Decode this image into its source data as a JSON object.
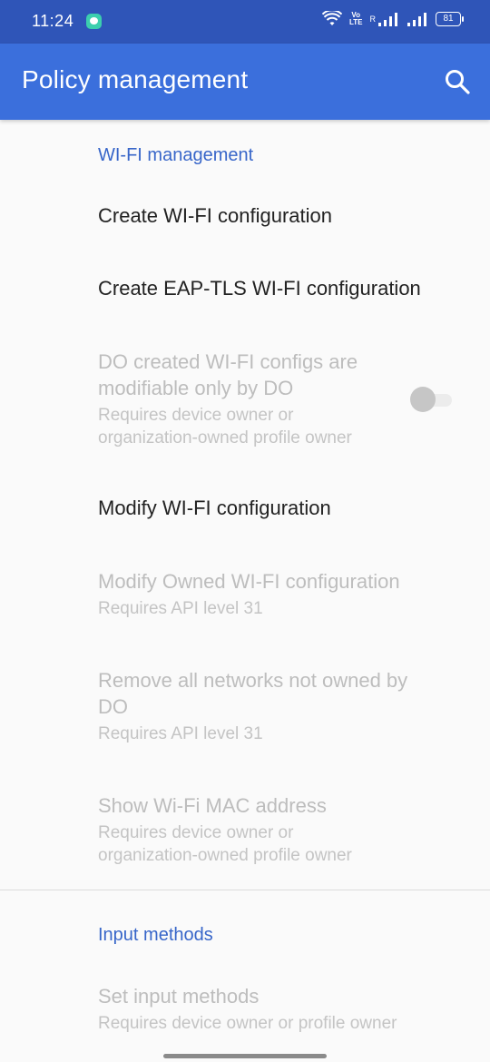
{
  "status_bar": {
    "time": "11:24",
    "volte_top": "Vo",
    "volte_bottom": "LTE",
    "signal_label": "R",
    "battery": "81",
    "bg_color": "#2f55b8"
  },
  "app_bar": {
    "title": "Policy management",
    "search_icon": "search-icon",
    "bg_color": "#3b6fdc"
  },
  "sections": {
    "wifi": {
      "header": "WI-FI management",
      "items": [
        {
          "title": "Create WI-FI configuration",
          "enabled": true
        },
        {
          "title": "Create EAP-TLS WI-FI configuration",
          "enabled": true
        },
        {
          "title": "DO created WI-FI configs are modifiable only by DO",
          "summary": "Requires device owner or organization-owned profile owner",
          "enabled": false,
          "toggle": false
        },
        {
          "title": "Modify WI-FI configuration",
          "enabled": true
        },
        {
          "title": "Modify Owned WI-FI configuration",
          "summary": "Requires API level 31",
          "enabled": false
        },
        {
          "title": "Remove all networks not owned by DO",
          "summary": "Requires API level 31",
          "enabled": false
        },
        {
          "title": "Show Wi-Fi MAC address",
          "summary": "Requires device owner or organization-owned profile owner",
          "enabled": false
        }
      ]
    },
    "input": {
      "header": "Input methods",
      "items": [
        {
          "title": "Set input methods",
          "summary": "Requires device owner or profile owner",
          "enabled": false
        }
      ]
    }
  },
  "accent_color": "#3866c9"
}
